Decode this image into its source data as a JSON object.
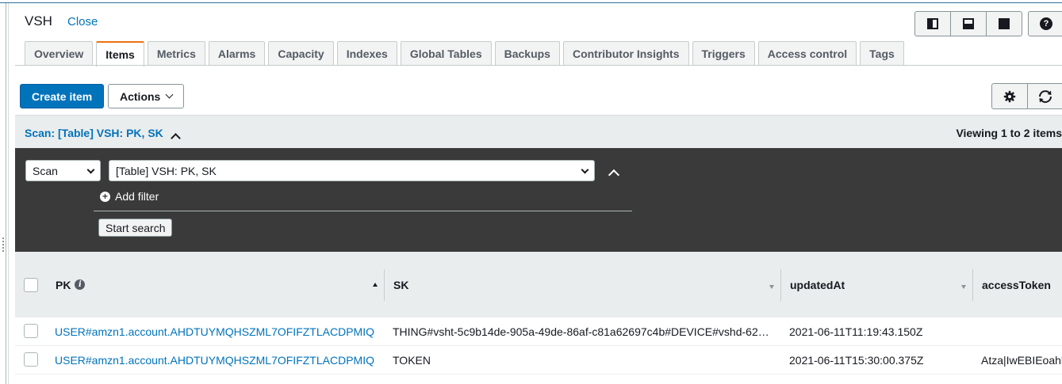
{
  "header": {
    "title": "VSH",
    "close_label": "Close",
    "help_label": "?"
  },
  "tabs": [
    {
      "label": "Overview"
    },
    {
      "label": "Items"
    },
    {
      "label": "Metrics"
    },
    {
      "label": "Alarms"
    },
    {
      "label": "Capacity"
    },
    {
      "label": "Indexes"
    },
    {
      "label": "Global Tables"
    },
    {
      "label": "Backups"
    },
    {
      "label": "Contributor Insights"
    },
    {
      "label": "Triggers"
    },
    {
      "label": "Access control"
    },
    {
      "label": "Tags"
    }
  ],
  "active_tab": "Items",
  "toolbar": {
    "create_label": "Create item",
    "actions_label": "Actions",
    "settings_icon": "gear-icon",
    "refresh_icon": "refresh-icon"
  },
  "scan": {
    "title": "Scan: [Table] VSH: PK, SK",
    "viewing": "Viewing 1 to 2 items",
    "mode_value": "Scan",
    "target_value": "[Table] VSH: PK, SK",
    "add_filter_label": "Add filter",
    "start_search_label": "Start search"
  },
  "table": {
    "columns": [
      "PK",
      "SK",
      "updatedAt",
      "accessToken"
    ],
    "rows": [
      {
        "pk": "USER#amzn1.account.AHDTUYMQHSZML7OFIFZTLACDPMIQ",
        "sk": "THING#vsht-5c9b14de-905a-49de-86af-c81a62697c4b#DEVICE#vshd-62…",
        "updatedAt": "2021-06-11T11:19:43.150Z",
        "accessToken": ""
      },
      {
        "pk": "USER#amzn1.account.AHDTUYMQHSZML7OFIFZTLACDPMIQ",
        "sk": "TOKEN",
        "updatedAt": "2021-06-11T15:30:00.375Z",
        "accessToken": "Atza|IwEBIEoahh"
      }
    ]
  },
  "colors": {
    "accent": "#0073bb",
    "active_tab": "#ec7211",
    "dark_panel": "#3a3a3a"
  }
}
